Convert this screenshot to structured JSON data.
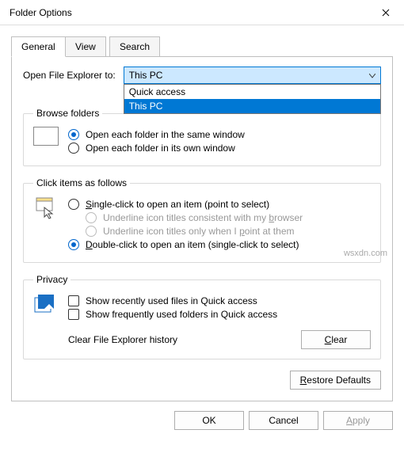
{
  "window": {
    "title": "Folder Options"
  },
  "tabs": {
    "general": "General",
    "view": "View",
    "search": "Search"
  },
  "open_to": {
    "label": "Open File Explorer to:",
    "selected": "This PC",
    "options": [
      "Quick access",
      "This PC"
    ],
    "highlighted_index": 1
  },
  "browse": {
    "legend": "Browse folders",
    "same": "Open each folder in the same window",
    "own": "Open each folder in its own window"
  },
  "click": {
    "legend": "Click items as follows",
    "single": "Single-click to open an item (point to select)",
    "underline_browser": "Underline icon titles consistent with my browser",
    "underline_point": "Underline icon titles only when I point at them",
    "double": "Double-click to open an item (single-click to select)"
  },
  "privacy": {
    "legend": "Privacy",
    "recent_files": "Show recently used files in Quick access",
    "frequent_folders": "Show frequently used folders in Quick access",
    "clear_label": "Clear File Explorer history",
    "clear_btn": "Clear"
  },
  "restore": "Restore Defaults",
  "buttons": {
    "ok": "OK",
    "cancel": "Cancel",
    "apply": "Apply"
  },
  "watermark": "wsxdn.com"
}
